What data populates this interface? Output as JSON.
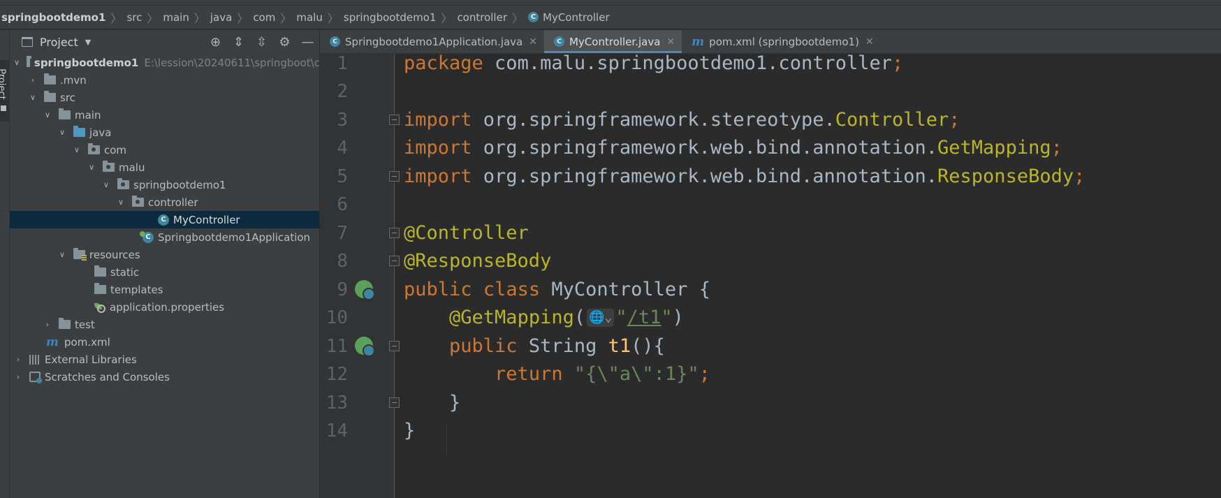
{
  "breadcrumb": [
    "springbootdemo1",
    "src",
    "main",
    "java",
    "com",
    "malu",
    "springbootdemo1",
    "controller",
    "MyController"
  ],
  "tool_strip": {
    "project_label": "Project"
  },
  "project_panel": {
    "title": "Project",
    "tree": [
      {
        "label": "springbootdemo1",
        "hint": "E:\\lession\\20240611\\springboot\\c",
        "depth": 0,
        "expanded": true,
        "icon": "module-folder-icon"
      },
      {
        "label": ".mvn",
        "depth": 1,
        "expanded": false,
        "icon": "folder-icon"
      },
      {
        "label": "src",
        "depth": 1,
        "expanded": true,
        "icon": "folder-icon"
      },
      {
        "label": "main",
        "depth": 2,
        "expanded": true,
        "icon": "folder-icon"
      },
      {
        "label": "java",
        "depth": 3,
        "expanded": true,
        "icon": "source-folder-icon"
      },
      {
        "label": "com",
        "depth": 4,
        "expanded": true,
        "icon": "package-icon"
      },
      {
        "label": "malu",
        "depth": 5,
        "expanded": true,
        "icon": "package-icon"
      },
      {
        "label": "springbootdemo1",
        "depth": 6,
        "expanded": true,
        "icon": "package-icon"
      },
      {
        "label": "controller",
        "depth": 7,
        "expanded": true,
        "icon": "package-icon"
      },
      {
        "label": "MyController",
        "depth": 8,
        "icon": "class-icon",
        "selected": true
      },
      {
        "label": "Springbootdemo1Application",
        "depth": 7,
        "icon": "spring-boot-class-icon"
      },
      {
        "label": "resources",
        "depth": 3,
        "expanded": true,
        "icon": "resources-folder-icon"
      },
      {
        "label": "static",
        "depth": 4,
        "icon": "folder-icon"
      },
      {
        "label": "templates",
        "depth": 4,
        "icon": "folder-icon"
      },
      {
        "label": "application.properties",
        "depth": 4,
        "icon": "spring-properties-icon"
      },
      {
        "label": "test",
        "depth": 2,
        "expanded": false,
        "icon": "folder-icon"
      },
      {
        "label": "pom.xml",
        "depth": 1,
        "icon": "maven-icon"
      },
      {
        "label": "External Libraries",
        "depth": 0,
        "expanded": false,
        "icon": "libraries-icon"
      },
      {
        "label": "Scratches and Consoles",
        "depth": 0,
        "expanded": false,
        "icon": "scratches-icon"
      }
    ]
  },
  "tabs": [
    {
      "label": "Springbootdemo1Application.java",
      "active": false,
      "icon": "spring-boot-class-icon"
    },
    {
      "label": "MyController.java",
      "active": true,
      "icon": "class-icon"
    },
    {
      "label": "pom.xml (springbootdemo1)",
      "active": false,
      "icon": "maven-icon"
    }
  ],
  "editor": {
    "line_numbers": [
      "1",
      "2",
      "3",
      "4",
      "5",
      "6",
      "7",
      "8",
      "9",
      "10",
      "11",
      "12",
      "13",
      "14"
    ],
    "tokens": {
      "l1_kw": "package",
      "l1_pkg": " com.malu.springbootdemo1.controller",
      "semicolon": ";",
      "import_kw": "import",
      "l3_pkg": " org.springframework.stereotype.",
      "l3_cls": "Controller",
      "l4_pkg": " org.springframework.web.bind.annotation.",
      "l4_cls": "GetMapping",
      "l5_pkg": " org.springframework.web.bind.annotation.",
      "l5_cls": "ResponseBody",
      "l7_ann": "@Controller",
      "l8_ann": "@ResponseBody",
      "l9_kw1": "public",
      "l9_kw2": "class",
      "l9_name": "MyController",
      "l9_brace": " {",
      "l10_ann": "@GetMapping",
      "l10_paren_open": "(",
      "l10_quote": "\"",
      "l10_url": "/t1",
      "l10_paren_close": ")",
      "l11_kw": "public",
      "l11_type": " String ",
      "l11_fn": "t1",
      "l11_rest": "(){",
      "l12_kw": "return",
      "l12_str": "\"{\\\"a\\\":1}\"",
      "l13_brace": "}",
      "l14_brace": "}"
    }
  },
  "colors": {
    "keyword": "#cc7832",
    "annotation": "#bbb529",
    "string": "#6a8759",
    "function": "#ffc66d",
    "text": "#a9b7c6",
    "accent": "#4a88c7"
  }
}
